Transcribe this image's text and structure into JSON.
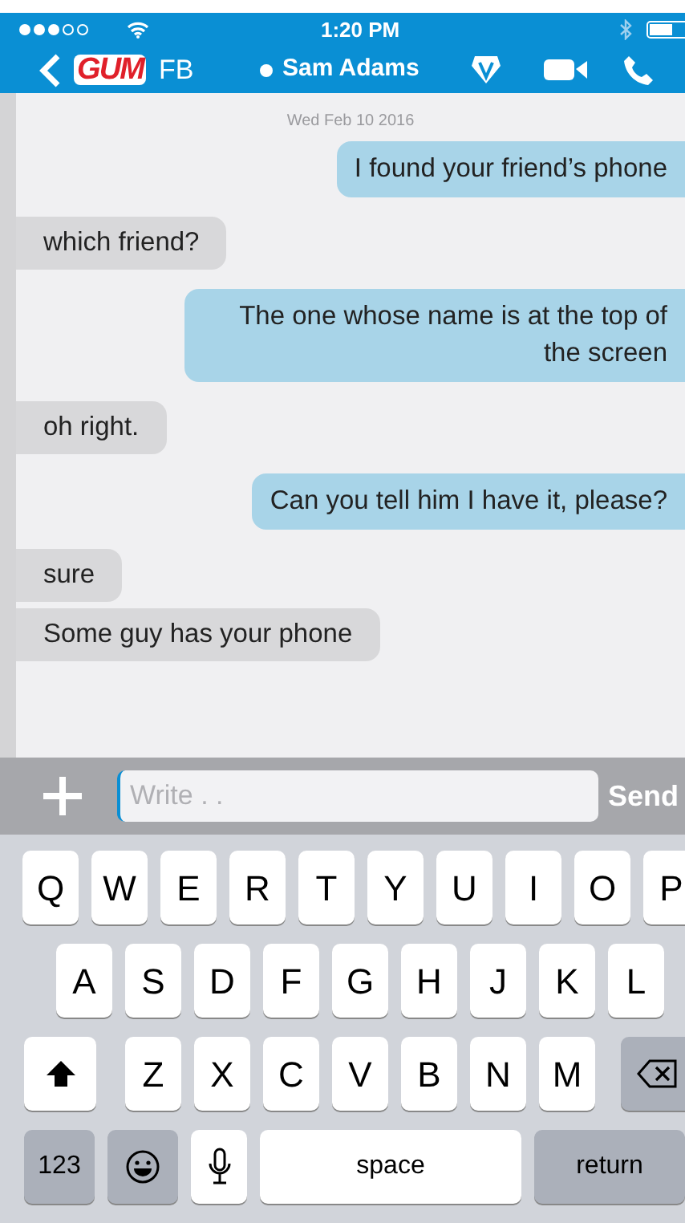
{
  "status_bar": {
    "time": "1:20 PM"
  },
  "nav_bar": {
    "logo": "GUM",
    "account": "FB",
    "contact": {
      "name": "Sam Adams",
      "online": true
    }
  },
  "conversation": {
    "date": "Wed Feb 10 2016",
    "messages": [
      {
        "kind": "sent",
        "text": "I found your friend’s phone"
      },
      {
        "kind": "received",
        "text": "which friend?"
      },
      {
        "kind": "sent",
        "text": "The one whose name is at the top of the screen"
      },
      {
        "kind": "received",
        "text": "oh right."
      },
      {
        "kind": "sent",
        "text": "Can you tell him I have it, please?"
      },
      {
        "kind": "received",
        "text": "sure"
      },
      {
        "kind": "received",
        "text": "Some guy has your phone"
      }
    ]
  },
  "composer": {
    "placeholder": "Write . .",
    "send": "Send"
  },
  "keyboard": {
    "rows": [
      {
        "keys": [
          {
            "kind": "letter",
            "label": "Q"
          },
          {
            "kind": "letter",
            "label": "W"
          },
          {
            "kind": "letter",
            "label": "E"
          },
          {
            "kind": "letter",
            "label": "R"
          },
          {
            "kind": "letter",
            "label": "T"
          },
          {
            "kind": "letter",
            "label": "Y"
          },
          {
            "kind": "letter",
            "label": "U"
          },
          {
            "kind": "letter",
            "label": "I"
          },
          {
            "kind": "letter",
            "label": "O"
          },
          {
            "kind": "letter",
            "label": "P"
          }
        ]
      },
      {
        "keys": [
          {
            "kind": "letter",
            "label": "A"
          },
          {
            "kind": "letter",
            "label": "S"
          },
          {
            "kind": "letter",
            "label": "D"
          },
          {
            "kind": "letter",
            "label": "F"
          },
          {
            "kind": "letter",
            "label": "G"
          },
          {
            "kind": "letter",
            "label": "H"
          },
          {
            "kind": "letter",
            "label": "J"
          },
          {
            "kind": "letter",
            "label": "K"
          },
          {
            "kind": "letter",
            "label": "L"
          }
        ]
      },
      {
        "keys": [
          {
            "kind": "shift"
          },
          {
            "kind": "letter",
            "label": "Z"
          },
          {
            "kind": "letter",
            "label": "X"
          },
          {
            "kind": "letter",
            "label": "C"
          },
          {
            "kind": "letter",
            "label": "V"
          },
          {
            "kind": "letter",
            "label": "B"
          },
          {
            "kind": "letter",
            "label": "N"
          },
          {
            "kind": "letter",
            "label": "M"
          },
          {
            "kind": "backspace"
          }
        ]
      },
      {
        "keys": [
          {
            "kind": "numbers",
            "label": "123"
          },
          {
            "kind": "emoji"
          },
          {
            "kind": "mic"
          },
          {
            "kind": "space",
            "label": "space"
          },
          {
            "kind": "return",
            "label": "return"
          }
        ]
      }
    ]
  }
}
